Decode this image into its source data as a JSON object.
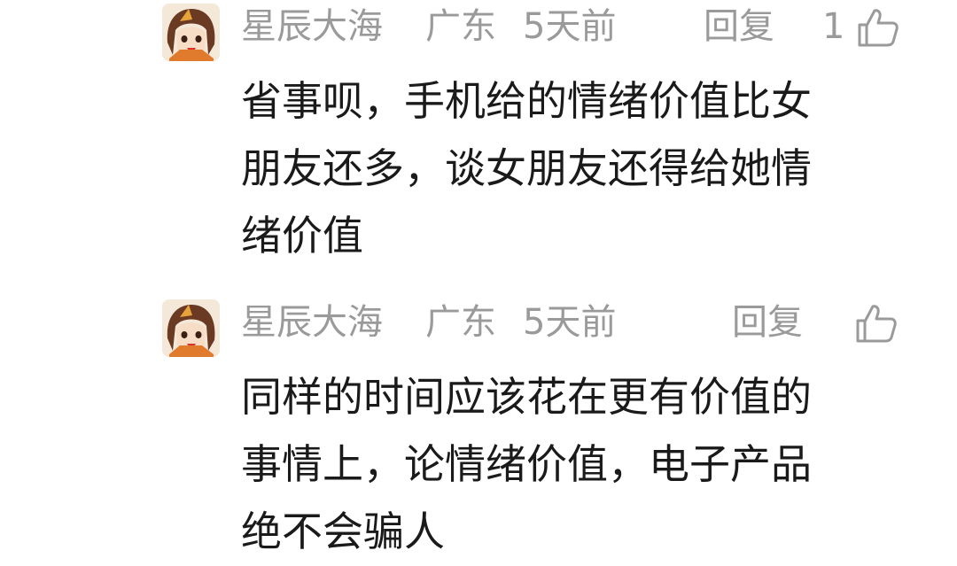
{
  "comments": [
    {
      "username": "星辰大海",
      "location": "广东",
      "time": "5天前",
      "reply_label": "回复",
      "like_count": "1",
      "lines": [
        "省事呗，手机给的情绪价值比女",
        "朋友还多，谈女朋友还得给她情",
        "绪价值"
      ]
    },
    {
      "username": "星辰大海",
      "location": "广东",
      "time": "5天前",
      "reply_label": "回复",
      "like_count": "",
      "lines": [
        "同样的时间应该花在更有价值的",
        "事情上，论情绪价值，电子产品",
        "绝不会骗人"
      ]
    }
  ],
  "colors": {
    "meta_text": "#9a9a9a",
    "body_text": "#1a1a1a",
    "background": "#ffffff"
  },
  "icons": {
    "like": "thumbs-up-outline-icon",
    "avatar": "anime-girl-avatar"
  }
}
